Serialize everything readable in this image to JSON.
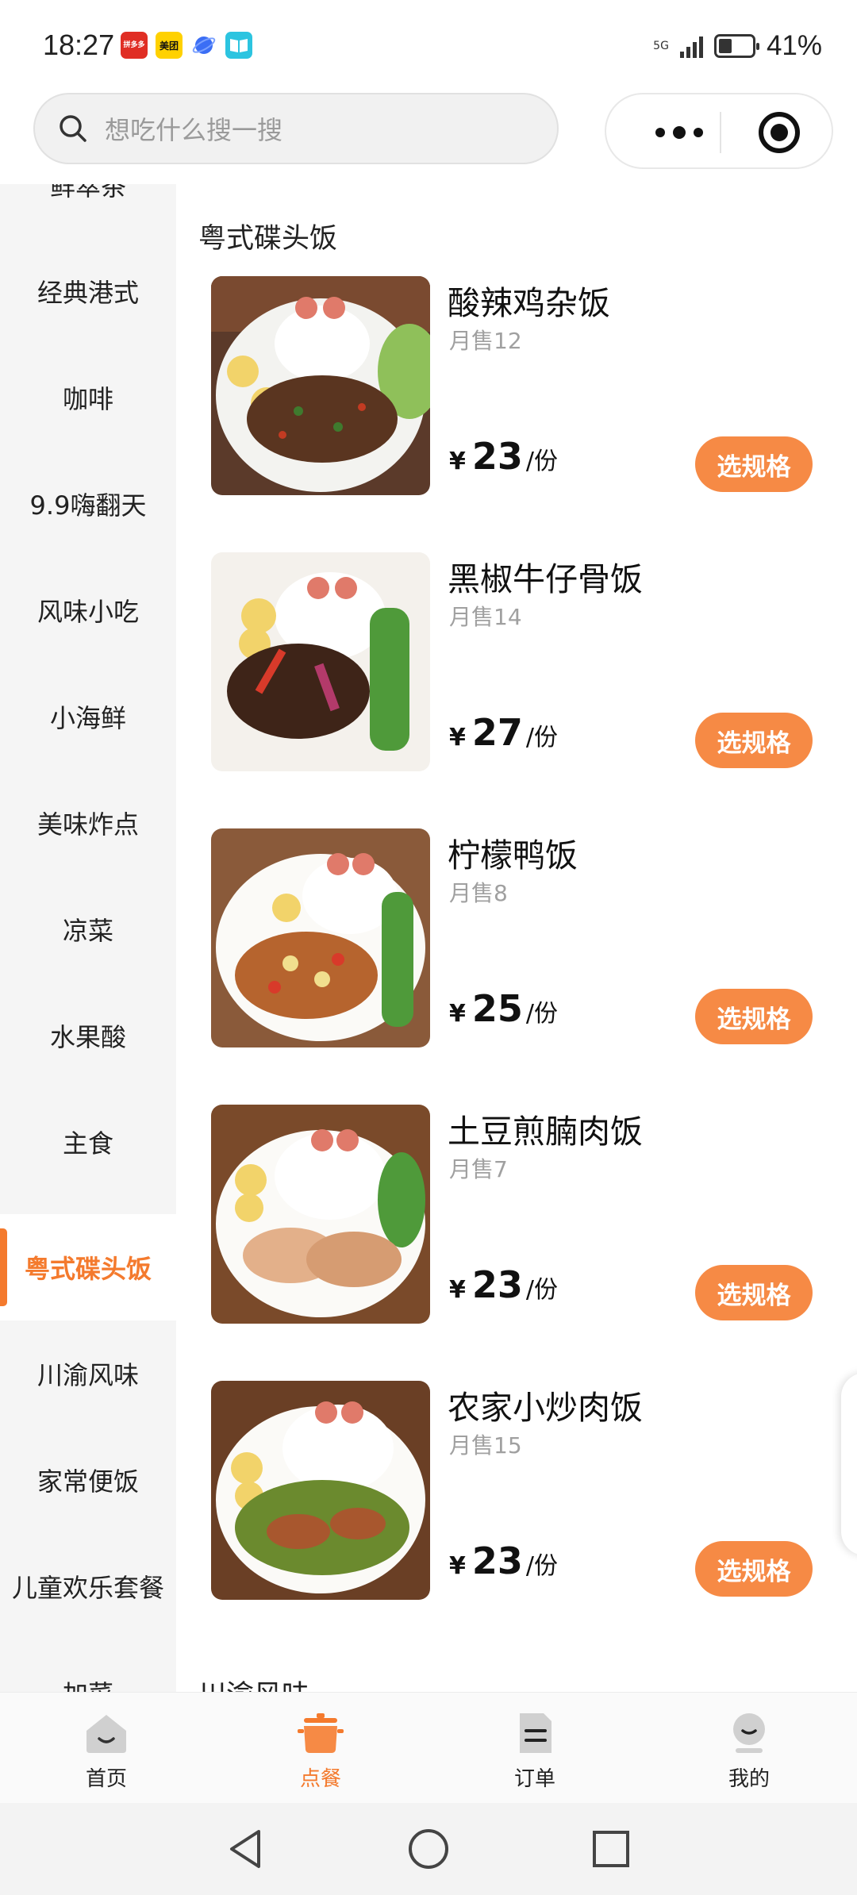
{
  "status_bar": {
    "time": "18:27",
    "apps": [
      {
        "name": "pinduoduo-app-icon",
        "label": "拼多多",
        "color": "#e02e24"
      },
      {
        "name": "meituan-app-icon",
        "label": "美团",
        "color": "#ffd100"
      },
      {
        "name": "browser-app-icon",
        "label": "",
        "color": "#3b6ef5"
      },
      {
        "name": "reader-app-icon",
        "label": "",
        "color": "#2cc4e0"
      }
    ],
    "network": "5G",
    "battery_level": 0.41,
    "battery_text": "41%"
  },
  "header": {
    "search_placeholder": "想吃什么搜一搜"
  },
  "sidebar": {
    "categories": [
      {
        "label": "鲜萃茶",
        "active": false
      },
      {
        "label": "经典港式",
        "active": false
      },
      {
        "label": "咖啡",
        "active": false
      },
      {
        "label": "9.9嗨翻天",
        "active": false
      },
      {
        "label": "风味小吃",
        "active": false
      },
      {
        "label": "小海鲜",
        "active": false
      },
      {
        "label": "美味炸点",
        "active": false
      },
      {
        "label": "凉菜",
        "active": false
      },
      {
        "label": "水果酸",
        "active": false
      },
      {
        "label": "主食",
        "active": false
      },
      {
        "label": "粤式碟头饭",
        "active": true
      },
      {
        "label": "川渝风味",
        "active": false
      },
      {
        "label": "家常便饭",
        "active": false
      },
      {
        "label": "儿童欢乐套餐",
        "active": false
      },
      {
        "label": "加菜",
        "active": false
      }
    ]
  },
  "main": {
    "section_title": "粤式碟头饭",
    "next_section_title": "川渝风味",
    "items": [
      {
        "name": "酸辣鸡杂饭",
        "sales": "月售12",
        "yen": "¥",
        "price": "23",
        "unit": "/份",
        "button": "选规格"
      },
      {
        "name": "黑椒牛仔骨饭",
        "sales": "月售14",
        "yen": "¥",
        "price": "27",
        "unit": "/份",
        "button": "选规格"
      },
      {
        "name": "柠檬鸭饭",
        "sales": "月售8",
        "yen": "¥",
        "price": "25",
        "unit": "/份",
        "button": "选规格"
      },
      {
        "name": "土豆煎腩肉饭",
        "sales": "月售7",
        "yen": "¥",
        "price": "23",
        "unit": "/份",
        "button": "选规格"
      },
      {
        "name": "农家小炒肉饭",
        "sales": "月售15",
        "yen": "¥",
        "price": "23",
        "unit": "/份",
        "button": "选规格"
      }
    ]
  },
  "tabbar": {
    "tabs": [
      {
        "label": "首页",
        "icon": "home-icon",
        "active": false
      },
      {
        "label": "点餐",
        "icon": "pot-icon",
        "active": true
      },
      {
        "label": "订单",
        "icon": "order-icon",
        "active": false
      },
      {
        "label": "我的",
        "icon": "profile-icon",
        "active": false
      }
    ],
    "accent_color": "#f47a2d"
  },
  "system_nav": {
    "buttons": [
      "back-icon",
      "home-circle-icon",
      "recents-icon"
    ]
  }
}
